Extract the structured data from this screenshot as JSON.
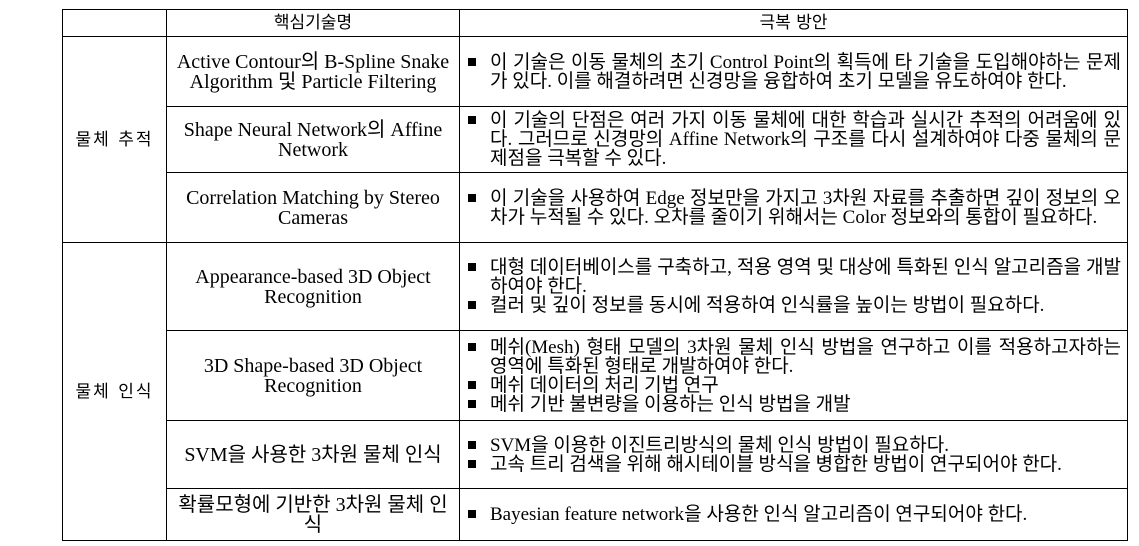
{
  "table": {
    "headers": [
      "",
      "핵심기술명",
      "극복 방안"
    ],
    "groups": [
      {
        "category": "물체 추적",
        "rows": [
          {
            "technology": "Active Contour의 B-Spline Snake Algorithm 및 Particle Filtering",
            "solutions": [
              "이 기술은 이동 물체의 초기 Control Point의 획득에 타 기술을 도입해야하는 문제가 있다. 이를 해결하려면 신경망을 융합하여 초기 모델을 유도하여야 한다."
            ]
          },
          {
            "technology": "Shape Neural Network의 Affine Network",
            "solutions": [
              "이 기술의 단점은 여러 가지 이동 물체에 대한 학습과 실시간 추적의 어려움에 있다. 그러므로 신경망의 Affine Network의 구조를 다시 설계하여야 다중 물체의 문제점을 극복할 수 있다."
            ]
          },
          {
            "technology": "Correlation Matching by Stereo Cameras",
            "solutions": [
              "이 기술을 사용하여 Edge 정보만을 가지고 3차원 자료를 추출하면 깊이 정보의 오차가 누적될 수 있다. 오차를 줄이기 위해서는 Color 정보와의 통합이 필요하다."
            ]
          }
        ]
      },
      {
        "category": "물체 인식",
        "rows": [
          {
            "technology": "Appearance-based 3D Object Recognition",
            "solutions": [
              "대형 데이터베이스를 구축하고, 적용 영역 및 대상에 특화된 인식 알고리즘을 개발하여야 한다.",
              "컬러 및 깊이 정보를 동시에 적용하여 인식률을 높이는 방법이 필요하다."
            ]
          },
          {
            "technology": "3D Shape-based 3D Object Recognition",
            "solutions": [
              "메쉬(Mesh) 형태 모델의 3차원 물체 인식 방법을 연구하고 이를 적용하고자하는 영역에 특화된 형태로 개발하여야 한다.",
              "메쉬 데이터의 처리 기법 연구",
              "메쉬 기반 불변량을 이용하는 인식 방법을 개발"
            ]
          },
          {
            "technology": "SVM을 사용한 3차원 물체 인식",
            "solutions": [
              "SVM을 이용한 이진트리방식의 물체 인식 방법이 필요하다.",
              "고속 트리 검색을 위해 해시테이블 방식을 병합한 방법이 연구되어야 한다."
            ]
          },
          {
            "technology": "확률모형에 기반한 3차원 물체 인식",
            "solutions": [
              "Bayesian feature network을 사용한 인식 알고리즘이 연구되어야 한다."
            ]
          }
        ]
      }
    ]
  }
}
